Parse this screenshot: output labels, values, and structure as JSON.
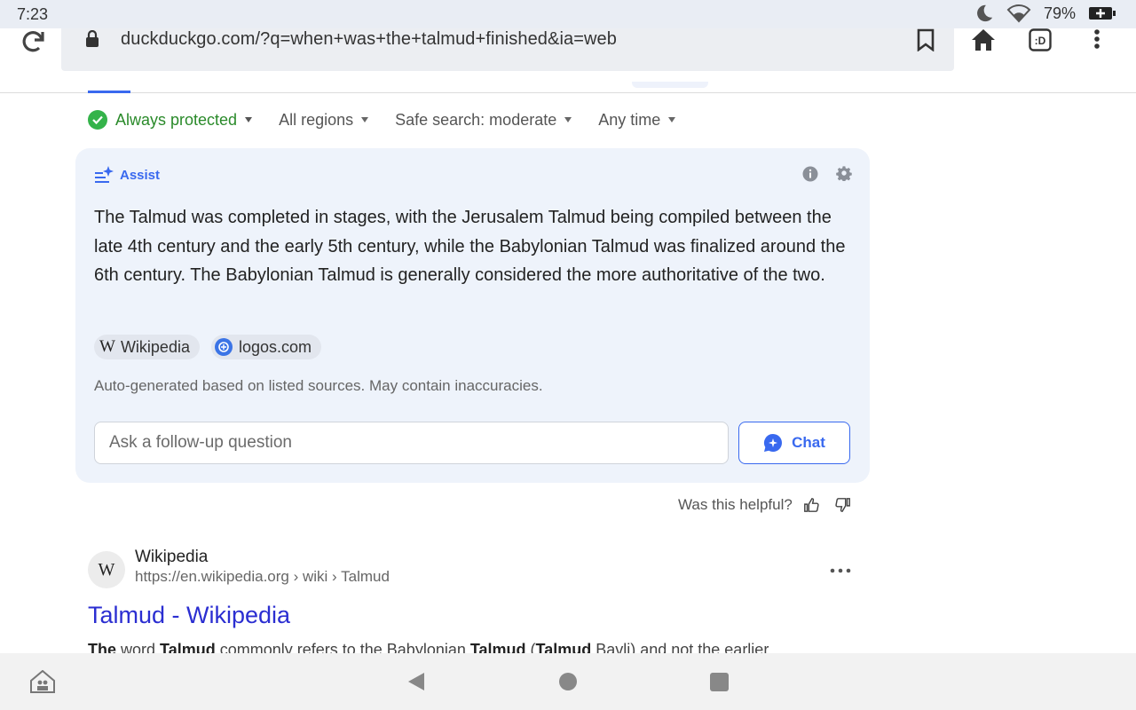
{
  "status": {
    "time": "7:23",
    "battery_percent": "79%"
  },
  "browser": {
    "url": "duckduckgo.com/?q=when+was+the+talmud+finished&ia=web",
    "ddg_tab_label": ":D"
  },
  "filters": [
    {
      "label": "Always protected"
    },
    {
      "label": "All regions"
    },
    {
      "label": "Safe search: moderate"
    },
    {
      "label": "Any time"
    }
  ],
  "assist": {
    "label": "Assist",
    "answer": "The Talmud was completed in stages, with the Jerusalem Talmud being compiled between the late 4th century and the early 5th century, while the Babylonian Talmud was finalized around the 6th century. The Babylonian Talmud is generally considered the more authoritative of the two.",
    "sources": [
      {
        "label": "Wikipedia",
        "glyph": "W"
      },
      {
        "label": "logos.com"
      }
    ],
    "disclaimer": "Auto-generated based on listed sources. May contain inaccuracies.",
    "followup_placeholder": "Ask a follow-up question",
    "chat_label": "Chat"
  },
  "feedback": {
    "label": "Was this helpful?"
  },
  "result": {
    "favicon_glyph": "W",
    "site": "Wikipedia",
    "url": "https://en.wikipedia.org › wiki › Talmud",
    "title": "Talmud - Wikipedia",
    "snippet_parts": [
      "The",
      " word ",
      "Talmud",
      " commonly refers to the Babylonian ",
      "Talmud",
      " (",
      "Talmud",
      " Bavli) and not the earlier"
    ]
  },
  "colors": {
    "accent": "#3969ef",
    "protected_green": "#34b34a",
    "card_bg": "#eef3fb",
    "result_title": "#2b2ed1"
  }
}
